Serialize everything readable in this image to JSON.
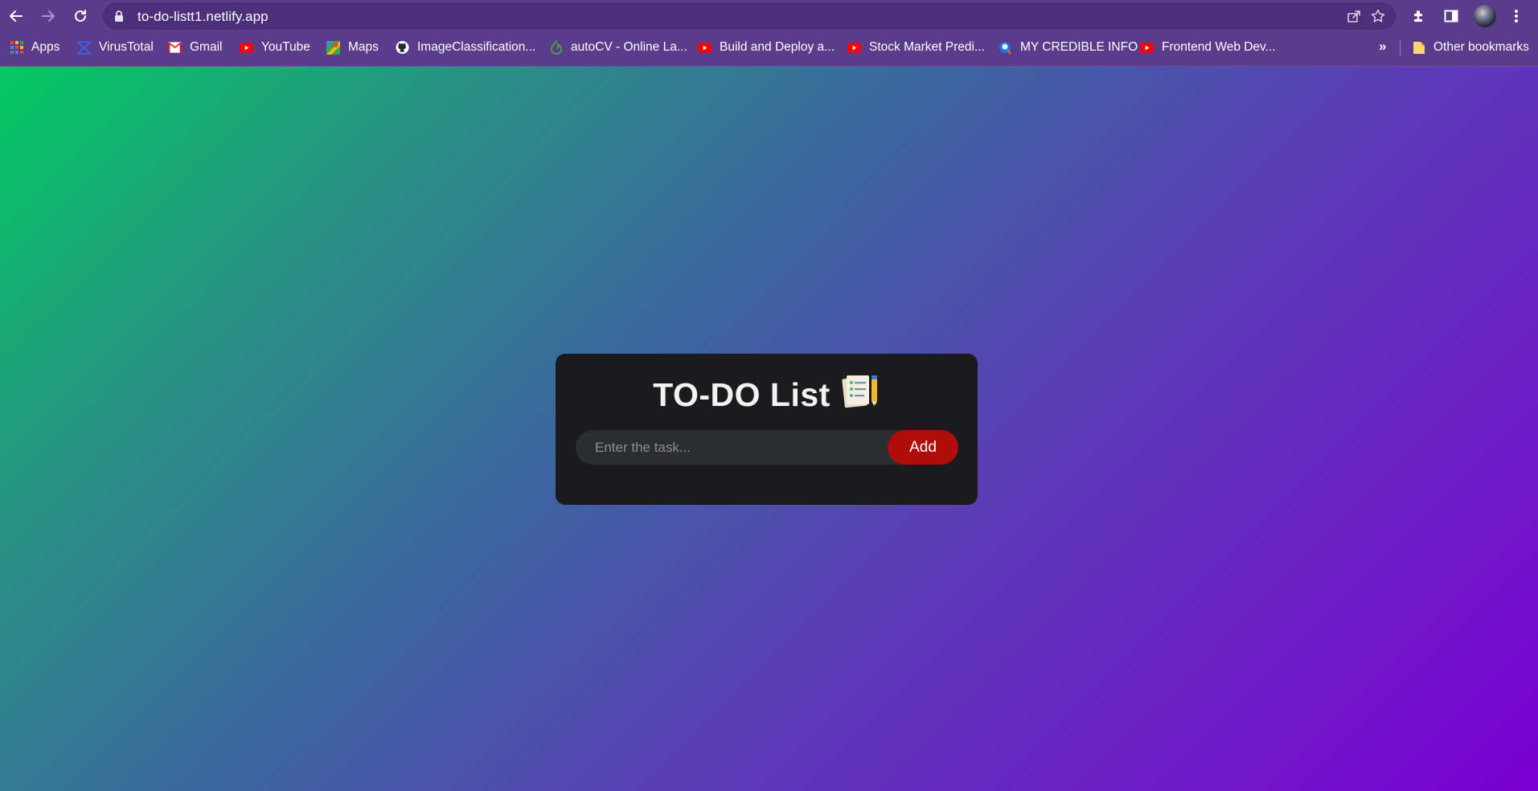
{
  "browser": {
    "url": "to-do-listt1.netlify.app",
    "bookmarks": [
      {
        "label": "Apps",
        "icon": "apps-grid-icon"
      },
      {
        "label": "VirusTotal",
        "icon": "virustotal-icon"
      },
      {
        "label": "Gmail",
        "icon": "gmail-icon"
      },
      {
        "label": "YouTube",
        "icon": "youtube-icon"
      },
      {
        "label": "Maps",
        "icon": "maps-icon"
      },
      {
        "label": "ImageClassification...",
        "icon": "github-icon"
      },
      {
        "label": "autoCV - Online La...",
        "icon": "overleaf-icon"
      },
      {
        "label": "Build and Deploy a...",
        "icon": "youtube-icon"
      },
      {
        "label": "Stock Market Predi...",
        "icon": "youtube-icon"
      },
      {
        "label": "MY CREDIBLE INFO",
        "icon": "credly-icon"
      },
      {
        "label": "Frontend Web Dev...",
        "icon": "youtube-icon"
      }
    ],
    "overflow_label": "»",
    "other_bookmarks": "Other bookmarks"
  },
  "app": {
    "title": "TO-DO List",
    "title_icon": "clipboard-checklist-icon",
    "input_placeholder": "Enter the task...",
    "add_label": "Add"
  },
  "colors": {
    "chrome": "#5b3b8c",
    "card": "#1b1b1d",
    "add_button": "#b00d0a",
    "gradient_start": "#03c961",
    "gradient_end": "#7a00d4"
  }
}
